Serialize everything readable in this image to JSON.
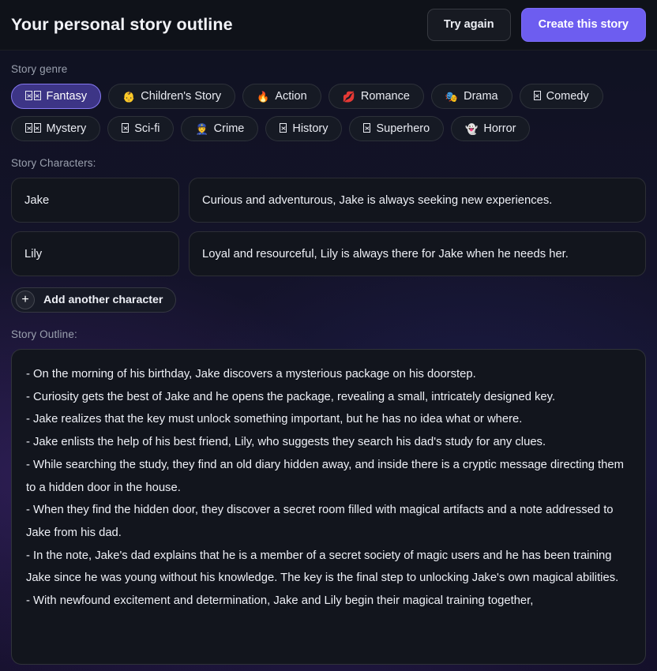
{
  "header": {
    "title": "Your personal story outline",
    "try_again_label": "Try again",
    "create_story_label": "Create this story"
  },
  "genre": {
    "label": "Story genre",
    "selected": "Fantasy",
    "options": [
      {
        "label": "Fantasy",
        "icon": "missing-glyph-double-icon",
        "selected": true
      },
      {
        "label": "Children's Story",
        "icon": "baby-face-icon",
        "selected": false
      },
      {
        "label": "Action",
        "icon": "fire-icon",
        "selected": false
      },
      {
        "label": "Romance",
        "icon": "kiss-mark-icon",
        "selected": false
      },
      {
        "label": "Drama",
        "icon": "theatre-masks-icon",
        "selected": false
      },
      {
        "label": "Comedy",
        "icon": "missing-glyph-icon",
        "selected": false
      },
      {
        "label": "Mystery",
        "icon": "missing-glyph-double-icon",
        "selected": false
      },
      {
        "label": "Sci-fi",
        "icon": "missing-glyph-icon",
        "selected": false
      },
      {
        "label": "Crime",
        "icon": "police-officer-icon",
        "selected": false
      },
      {
        "label": "History",
        "icon": "missing-glyph-icon",
        "selected": false
      },
      {
        "label": "Superhero",
        "icon": "missing-glyph-icon",
        "selected": false
      },
      {
        "label": "Horror",
        "icon": "ghost-icon",
        "selected": false
      }
    ]
  },
  "characters": {
    "label": "Story Characters:",
    "rows": [
      {
        "name": "Jake",
        "description": "Curious and adventurous, Jake is always seeking new experiences."
      },
      {
        "name": "Lily",
        "description": "Loyal and resourceful, Lily is always there for Jake when he needs her."
      }
    ],
    "add_label": "Add another character",
    "add_icon": "plus-icon"
  },
  "outline": {
    "label": "Story Outline:",
    "lines": [
      "- On the morning of his birthday, Jake discovers a mysterious package on his doorstep.",
      "- Curiosity gets the best of Jake and he opens the package, revealing a small, intricately designed key.",
      "- Jake realizes that the key must unlock something important, but he has no idea what or where.",
      "- Jake enlists the help of his best friend, Lily, who suggests they search his dad's study for any clues.",
      "- While searching the study, they find an old diary hidden away, and inside there is a cryptic message directing them to a hidden door in the house.",
      "- When they find the hidden door, they discover a secret room filled with magical artifacts and a note addressed to Jake from his dad.",
      "- In the note, Jake's dad explains that he is a member of a secret society of magic users and he has been training Jake since he was young without his knowledge. The key is the final step to unlocking Jake's own magical abilities.",
      "- With newfound excitement and determination, Jake and Lily begin their magical training together,"
    ]
  },
  "colors": {
    "accent": "#6d5df0",
    "selected_chip_bg": "#3d3586",
    "selected_chip_border": "#8578f0",
    "page_bg": "#14132a",
    "panel_bg": "#12151d",
    "topbar_bg": "#0f1219",
    "muted_text": "#9aa0ae"
  }
}
